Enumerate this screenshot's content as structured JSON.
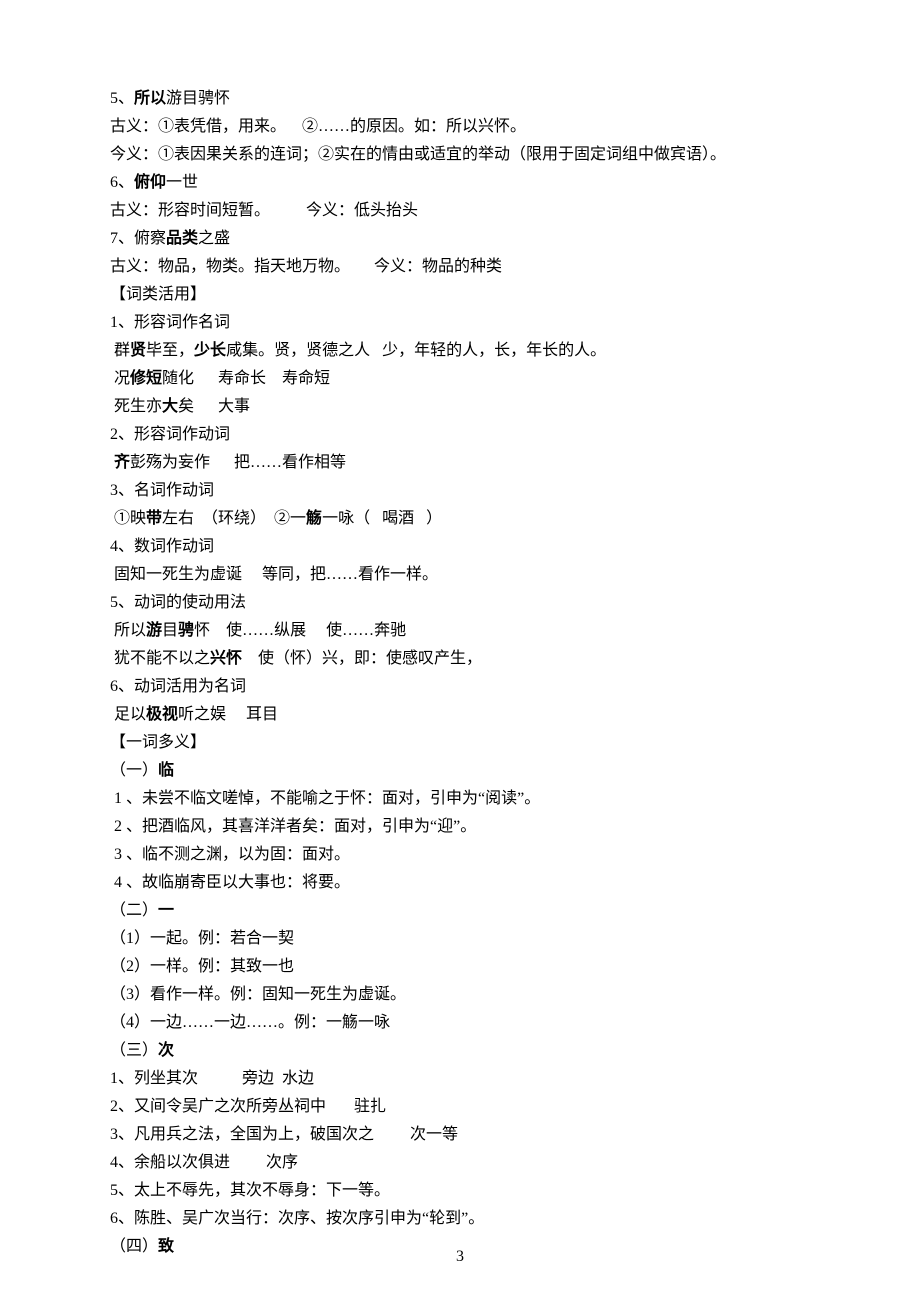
{
  "page_number": "3",
  "lines": [
    {
      "t": "plain",
      "segs": [
        {
          "txt": "5、"
        },
        {
          "txt": "所以",
          "b": true
        },
        {
          "txt": "游目骋怀"
        }
      ]
    },
    {
      "t": "plain",
      "segs": [
        {
          "txt": "古义：①表凭借，用来。    ②……的原因。如：所以兴怀。"
        }
      ]
    },
    {
      "t": "plain",
      "segs": [
        {
          "txt": "今义：①表因果关系的连词；②实在的情由或适宜的举动（限用于固定词组中做宾语）。"
        }
      ]
    },
    {
      "t": "plain",
      "segs": [
        {
          "txt": "6、"
        },
        {
          "txt": "俯仰",
          "b": true
        },
        {
          "txt": "一世"
        }
      ]
    },
    {
      "t": "plain",
      "segs": [
        {
          "txt": "古义：形容时间短暂。         今义：低头抬头"
        }
      ]
    },
    {
      "t": "plain",
      "segs": [
        {
          "txt": "7、俯察"
        },
        {
          "txt": "品类",
          "b": true
        },
        {
          "txt": "之盛"
        }
      ]
    },
    {
      "t": "plain",
      "segs": [
        {
          "txt": "古义：物品，物类。指天地万物。      今义：物品的种类"
        }
      ]
    },
    {
      "t": "plain",
      "segs": [
        {
          "txt": "【词类活用】"
        }
      ]
    },
    {
      "t": "plain",
      "segs": [
        {
          "txt": "1、形容词作名词"
        }
      ]
    },
    {
      "t": "plain",
      "segs": [
        {
          "txt": " 群"
        },
        {
          "txt": "贤",
          "b": true
        },
        {
          "txt": "毕至，"
        },
        {
          "txt": "少长",
          "b": true
        },
        {
          "txt": "咸集。贤，贤德之人   少，年轻的人，长，年长的人。"
        }
      ]
    },
    {
      "t": "plain",
      "segs": [
        {
          "txt": " 况"
        },
        {
          "txt": "修短",
          "b": true
        },
        {
          "txt": "随化      寿命长    寿命短"
        }
      ]
    },
    {
      "t": "plain",
      "segs": [
        {
          "txt": " 死生亦"
        },
        {
          "txt": "大",
          "b": true
        },
        {
          "txt": "矣      大事"
        }
      ]
    },
    {
      "t": "plain",
      "segs": [
        {
          "txt": "2、形容词作动词"
        }
      ]
    },
    {
      "t": "plain",
      "segs": [
        {
          "txt": " "
        },
        {
          "txt": "齐",
          "b": true
        },
        {
          "txt": "彭殇为妄作      把……看作相等"
        }
      ]
    },
    {
      "t": "plain",
      "segs": [
        {
          "txt": "3、名词作动词"
        }
      ]
    },
    {
      "t": "plain",
      "segs": [
        {
          "txt": " ①映"
        },
        {
          "txt": "带",
          "b": true
        },
        {
          "txt": "左右  （环绕）  ②一"
        },
        {
          "txt": "觞",
          "b": true
        },
        {
          "txt": "一咏（   喝酒   ）"
        }
      ]
    },
    {
      "t": "plain",
      "segs": [
        {
          "txt": "4、数词作动词"
        }
      ]
    },
    {
      "t": "plain",
      "segs": [
        {
          "txt": " 固知一死生为虚诞     等同，把……看作一样。"
        }
      ]
    },
    {
      "t": "plain",
      "segs": [
        {
          "txt": "5、动词的使动用法"
        }
      ]
    },
    {
      "t": "plain",
      "segs": [
        {
          "txt": " 所以"
        },
        {
          "txt": "游",
          "b": true
        },
        {
          "txt": "目"
        },
        {
          "txt": "骋",
          "b": true
        },
        {
          "txt": "怀    使……纵展     使……奔驰"
        }
      ]
    },
    {
      "t": "plain",
      "segs": [
        {
          "txt": " 犹不能不以之"
        },
        {
          "txt": "兴怀",
          "b": true
        },
        {
          "txt": "    使（怀）兴，即：使感叹产生，"
        }
      ]
    },
    {
      "t": "plain",
      "segs": [
        {
          "txt": "6、动词活用为名词"
        }
      ]
    },
    {
      "t": "plain",
      "segs": [
        {
          "txt": " 足以"
        },
        {
          "txt": "极视",
          "b": true
        },
        {
          "txt": "听之娱     耳目"
        }
      ]
    },
    {
      "t": "plain",
      "segs": [
        {
          "txt": "【一词多义】"
        }
      ]
    },
    {
      "t": "plain",
      "segs": [
        {
          "txt": "（一）"
        },
        {
          "txt": "临",
          "b": true
        }
      ]
    },
    {
      "t": "plain",
      "segs": [
        {
          "txt": " 1 、未尝不临文嗟悼，不能喻之于怀：面对，引申为“阅读”。"
        }
      ]
    },
    {
      "t": "plain",
      "segs": [
        {
          "txt": " 2 、把酒临风，其喜洋洋者矣：面对，引申为“迎”。"
        }
      ]
    },
    {
      "t": "plain",
      "segs": [
        {
          "txt": " 3 、临不测之渊，以为固：面对。"
        }
      ]
    },
    {
      "t": "plain",
      "segs": [
        {
          "txt": " 4 、故临崩寄臣以大事也：将要。"
        }
      ]
    },
    {
      "t": "plain",
      "segs": [
        {
          "txt": "（二）"
        },
        {
          "txt": "一",
          "b": true
        }
      ]
    },
    {
      "t": "plain",
      "segs": [
        {
          "txt": "（1）一起。例：若合一契"
        }
      ]
    },
    {
      "t": "plain",
      "segs": [
        {
          "txt": "（2）一样。例：其致一也"
        }
      ]
    },
    {
      "t": "plain",
      "segs": [
        {
          "txt": "（3）看作一样。例：固知一死生为虚诞。"
        }
      ]
    },
    {
      "t": "plain",
      "segs": [
        {
          "txt": "（4）一边……一边……。例：一觞一咏"
        }
      ]
    },
    {
      "t": "plain",
      "segs": [
        {
          "txt": "（三）"
        },
        {
          "txt": "次",
          "b": true
        }
      ]
    },
    {
      "t": "plain",
      "segs": [
        {
          "txt": "1、列坐其次           旁边  水边"
        }
      ]
    },
    {
      "t": "plain",
      "segs": [
        {
          "txt": "2、又间令吴广之次所旁丛祠中       驻扎"
        }
      ]
    },
    {
      "t": "plain",
      "segs": [
        {
          "txt": "3、凡用兵之法，全国为上，破国次之         次一等"
        }
      ]
    },
    {
      "t": "plain",
      "segs": [
        {
          "txt": "4、余船以次俱进         次序"
        }
      ]
    },
    {
      "t": "plain",
      "segs": [
        {
          "txt": "5、太上不辱先，其次不辱身：下一等。"
        }
      ]
    },
    {
      "t": "plain",
      "segs": [
        {
          "txt": "6、陈胜、吴广次当行：次序、按次序引申为“轮到”。"
        }
      ]
    },
    {
      "t": "plain",
      "segs": [
        {
          "txt": "（四）"
        },
        {
          "txt": "致",
          "b": true
        }
      ]
    }
  ]
}
